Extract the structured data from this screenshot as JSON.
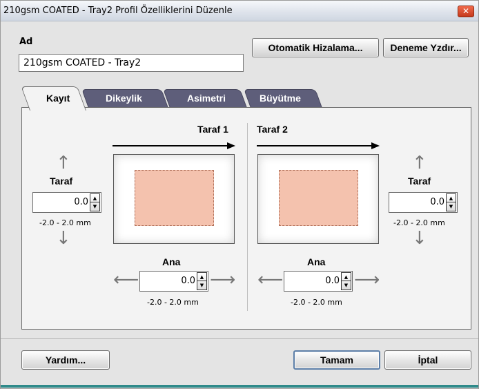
{
  "window": {
    "title": "210gsm COATED - Tray2 Profil Özelliklerini Düzenle",
    "close_glyph": "✕"
  },
  "name": {
    "label": "Ad",
    "value": "210gsm COATED - Tray2"
  },
  "top_buttons": {
    "auto_align": "Otomatik Hizalama...",
    "test_print": "Deneme Yzdır..."
  },
  "tabs": [
    {
      "label": "Kayıt",
      "active": true
    },
    {
      "label": "Dikeylik",
      "active": false
    },
    {
      "label": "Asimetri",
      "active": false
    },
    {
      "label": "Büyütme",
      "active": false
    }
  ],
  "side1": {
    "title": "Taraf 1",
    "lead": {
      "label": "Taraf",
      "value": "0.0",
      "range": "-2.0 - 2.0 mm"
    },
    "main": {
      "label": "Ana",
      "value": "0.0",
      "range": "-2.0 - 2.0 mm"
    }
  },
  "side2": {
    "title": "Taraf 2",
    "lead": {
      "label": "Taraf",
      "value": "0.0",
      "range": "-2.0 - 2.0 mm"
    },
    "main": {
      "label": "Ana",
      "value": "0.0",
      "range": "-2.0 - 2.0 mm"
    }
  },
  "icons": {
    "arrow_up": "arrow-up-icon",
    "arrow_down": "arrow-down-icon",
    "arrow_left": "arrow-left-icon",
    "arrow_right": "arrow-right-icon",
    "feed_arrow": "feed-direction-arrow-icon"
  },
  "footer": {
    "help": "Yardım...",
    "ok": "Tamam",
    "cancel": "İptal"
  },
  "colors": {
    "image_area": "#f4c2ae",
    "tab_inactive": "#5e5e7a",
    "accent_line": "#2f8a8a"
  }
}
